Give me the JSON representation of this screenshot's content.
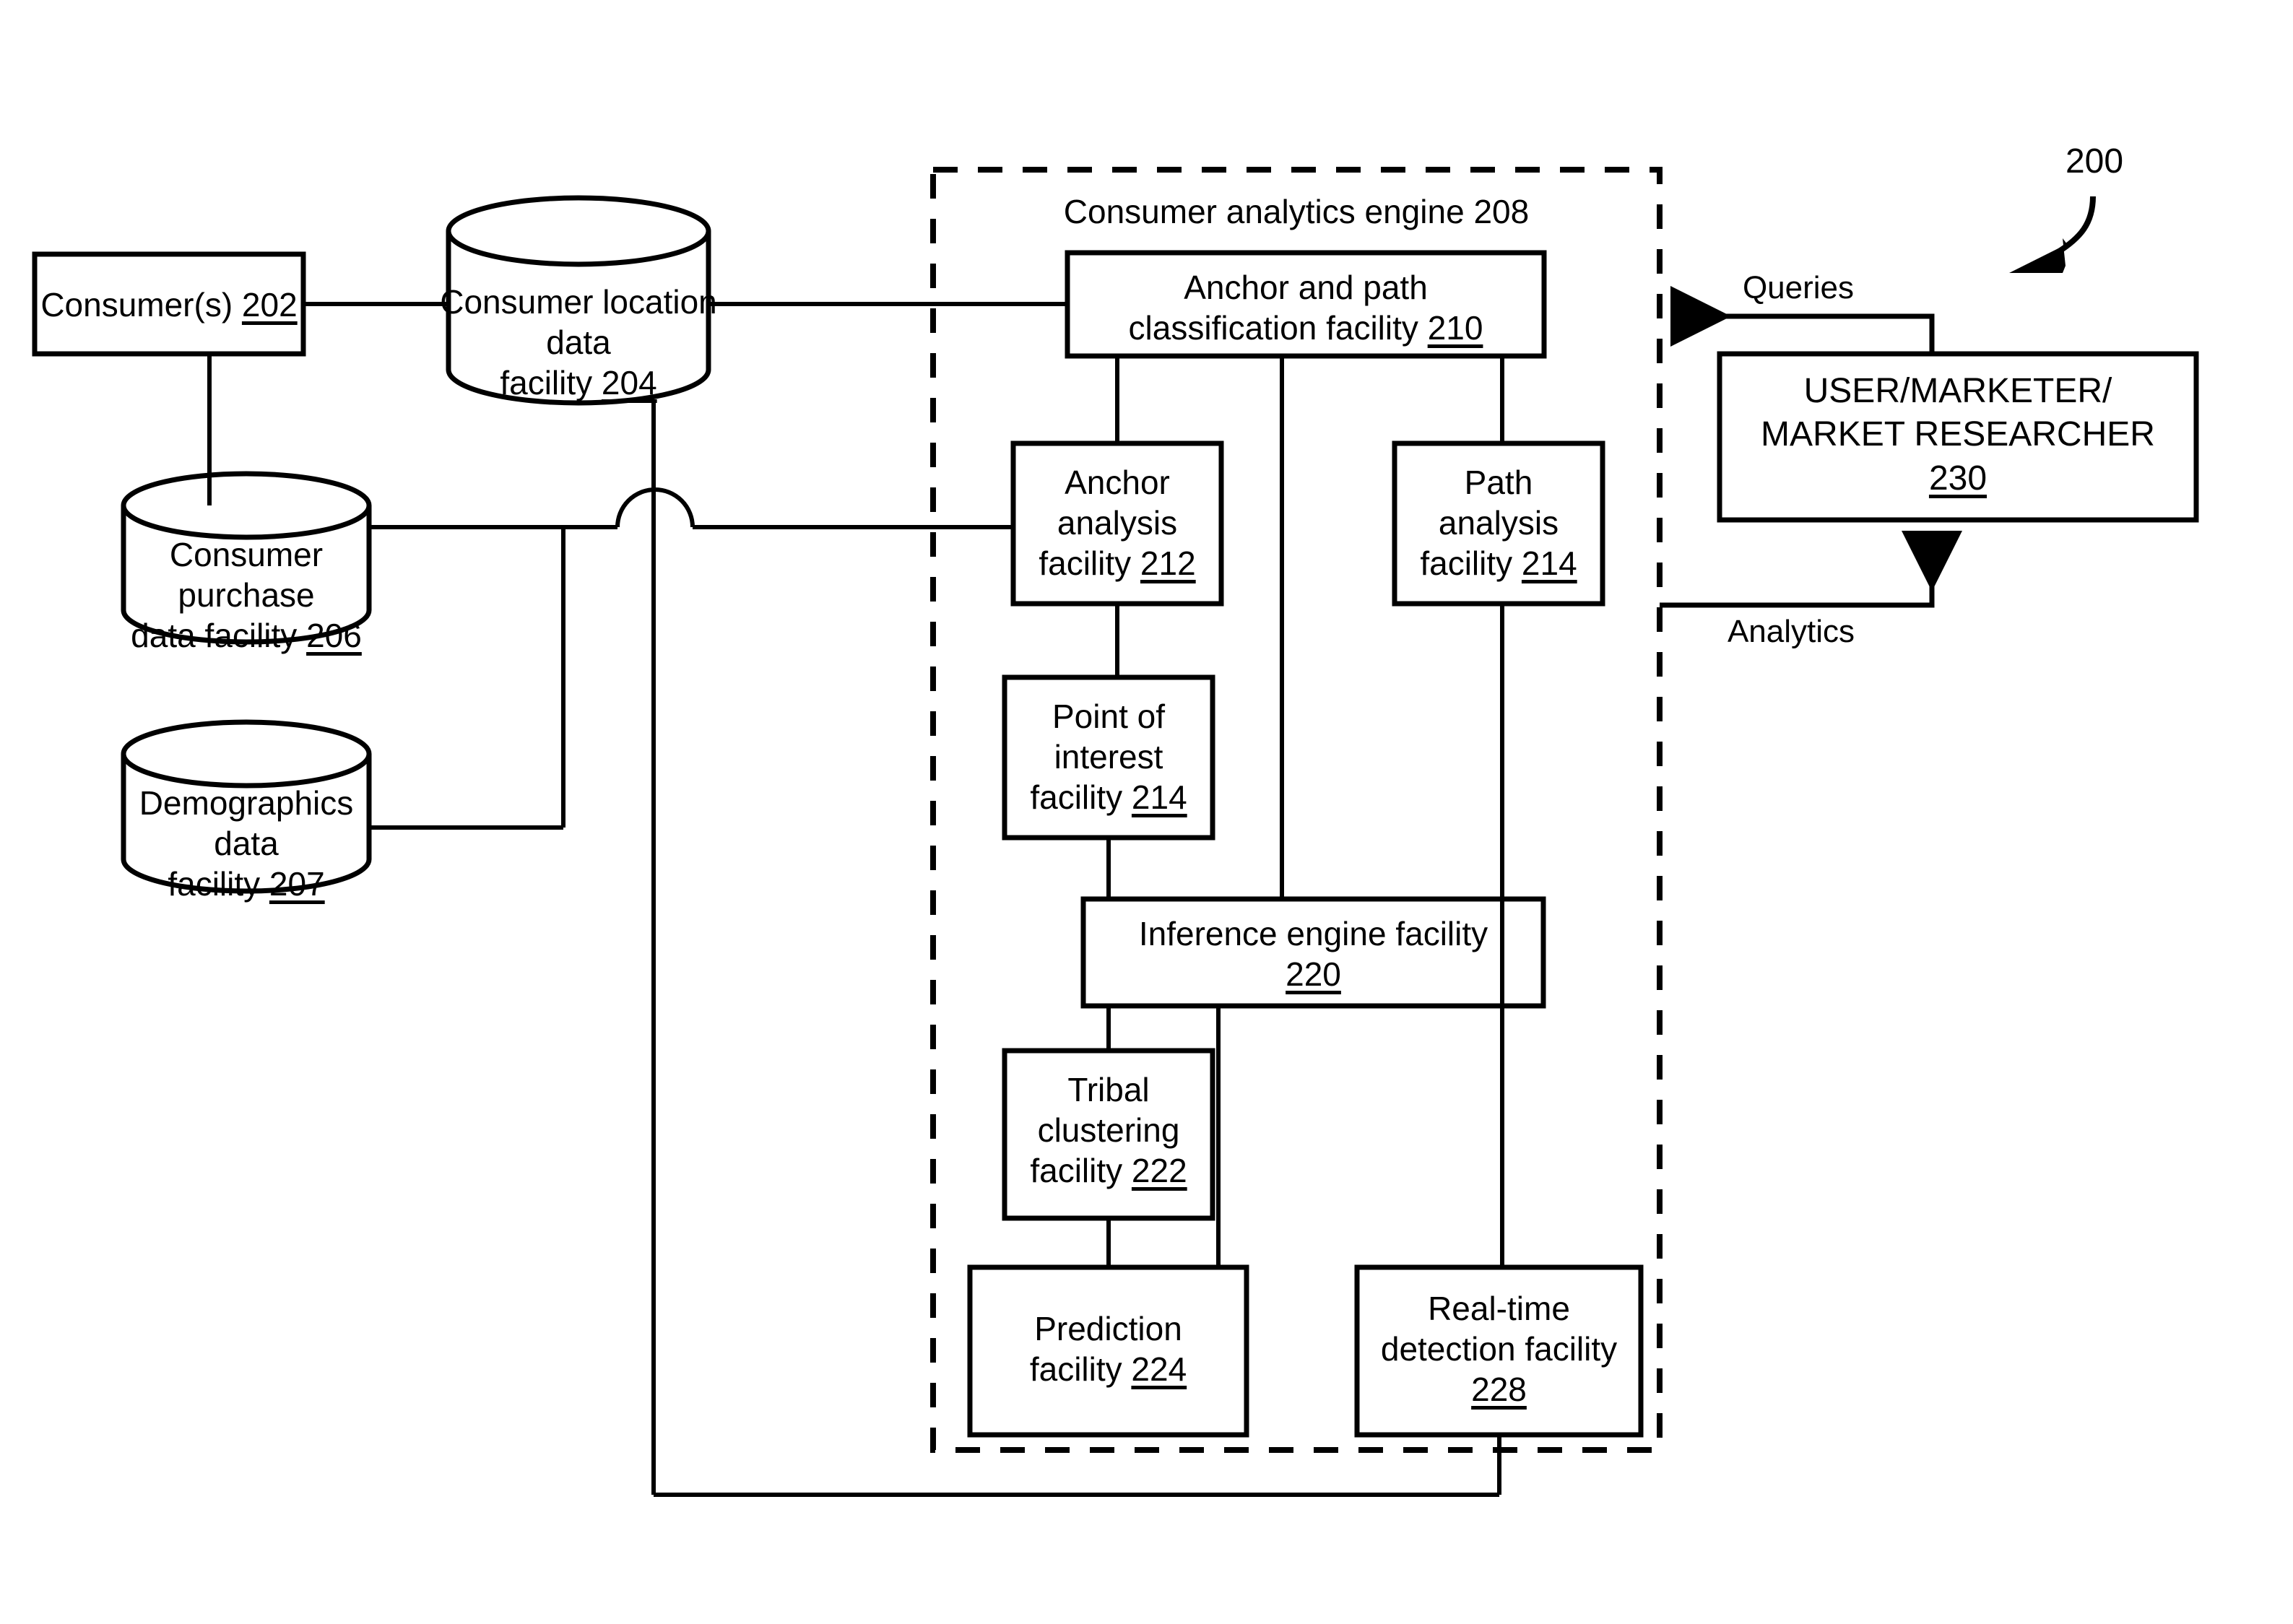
{
  "figure": {
    "reference_numeral": "200",
    "engine_group": {
      "title": "Consumer analytics engine 208",
      "title_text": "Consumer analytics engine ",
      "title_ref": "208"
    }
  },
  "nodes": {
    "consumers": {
      "shape": "rect",
      "text": "Consumer(s) ",
      "ref": "202",
      "full": "Consumer(s) 202"
    },
    "location_data": {
      "shape": "cylinder",
      "text": "Consumer location data\nfacility ",
      "ref": "204",
      "full": "Consumer location data facility 204"
    },
    "purchase_data": {
      "shape": "cylinder",
      "text": "Consumer purchase\ndata facility ",
      "ref": "206",
      "full": "Consumer purchase data facility 206"
    },
    "demographics_data": {
      "shape": "cylinder",
      "text": "Demographics data\nfacility ",
      "ref": "207",
      "full": "Demographics data facility 207"
    },
    "anchor_path_classification": {
      "shape": "rect",
      "text": "Anchor and path\nclassification facility ",
      "ref": "210",
      "full": "Anchor and path classification facility 210"
    },
    "anchor_analysis": {
      "shape": "rect",
      "text": "Anchor\nanalysis\nfacility ",
      "ref": "212",
      "full": "Anchor analysis facility 212"
    },
    "path_analysis": {
      "shape": "rect",
      "text": "Path\nanalysis\nfacility ",
      "ref": "214",
      "full": "Path analysis facility 214"
    },
    "point_of_interest": {
      "shape": "rect",
      "text": "Point of\ninterest\nfacility ",
      "ref": "214",
      "full": "Point of interest facility 214"
    },
    "inference_engine": {
      "shape": "rect",
      "text": "Inference engine facility\n",
      "ref": "220",
      "full": "Inference engine facility 220"
    },
    "tribal_clustering": {
      "shape": "rect",
      "text": "Tribal\nclustering\nfacility ",
      "ref": "222",
      "full": "Tribal clustering facility 222"
    },
    "prediction": {
      "shape": "rect",
      "text": "Prediction\nfacility ",
      "ref": "224",
      "full": "Prediction facility 224"
    },
    "realtime_detection": {
      "shape": "rect",
      "text": "Real-time\ndetection facility\n",
      "ref": "228",
      "full": "Real-time detection facility 228"
    },
    "user_marketer": {
      "shape": "rect",
      "line1": "USER/MARKETER/",
      "line2": "MARKET RESEARCHER",
      "ref": "230",
      "full": "USER/MARKETER/ MARKET RESEARCHER 230"
    }
  },
  "edges": {
    "queries": {
      "label": "Queries",
      "direction": "user-to-engine"
    },
    "analytics": {
      "label": "Analytics",
      "direction": "engine-to-user"
    }
  },
  "style": {
    "stroke": "#000000",
    "background": "#ffffff",
    "stroke_width_box": 7,
    "stroke_width_line": 6
  }
}
